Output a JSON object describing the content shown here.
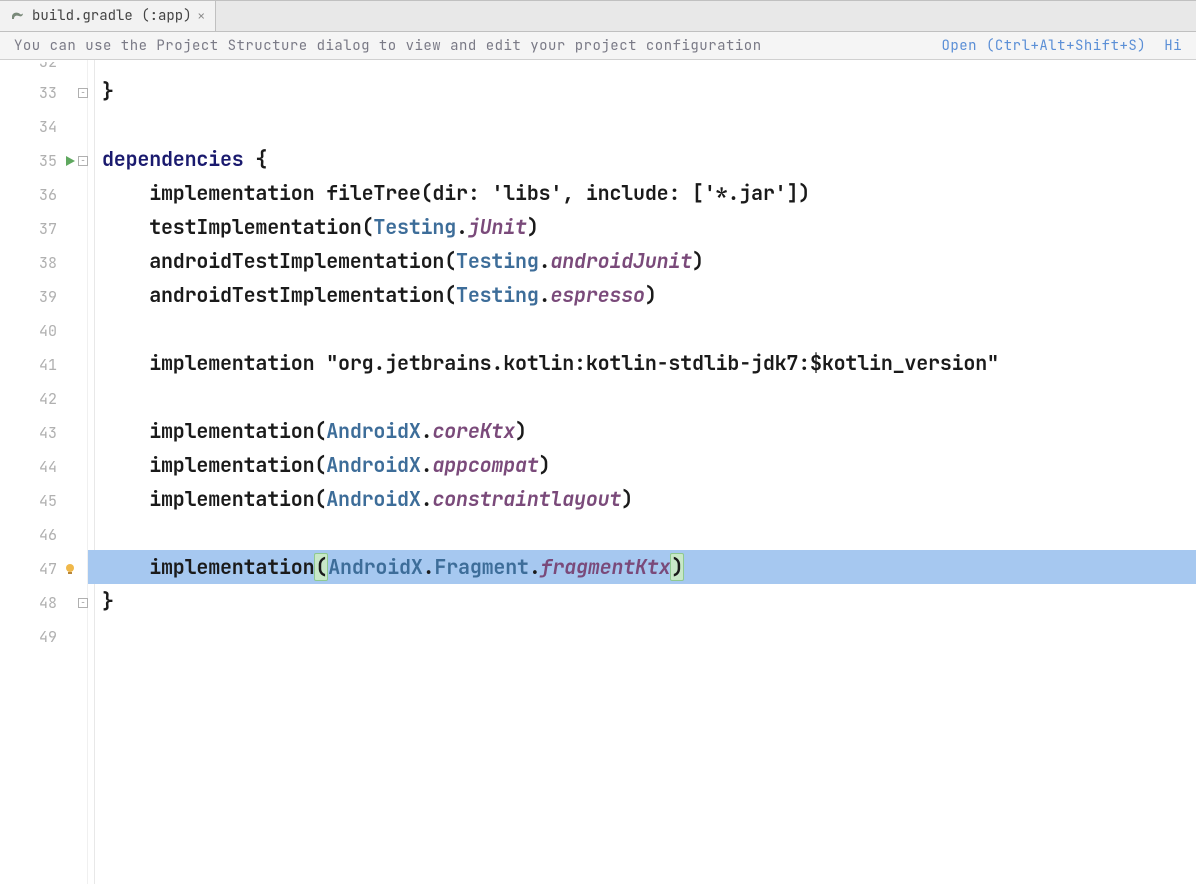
{
  "tab": {
    "label": "build.gradle (:app)"
  },
  "notice": {
    "text": "You can use the Project Structure dialog to view and edit your project configuration",
    "link1": "Open (Ctrl+Alt+Shift+S)",
    "link2": "Hi"
  },
  "lines": {
    "start": 32,
    "items": [
      {
        "num": 32,
        "partial": true
      },
      {
        "num": 33,
        "fold_close": true,
        "segments": [
          {
            "cls": "brace",
            "t": "}"
          }
        ]
      },
      {
        "num": 34,
        "segments": []
      },
      {
        "num": 35,
        "run": true,
        "fold_open": true,
        "segments": [
          {
            "cls": "kw",
            "t": "dependencies"
          },
          {
            "cls": "plain",
            "t": " "
          },
          {
            "cls": "brace",
            "t": "{"
          }
        ]
      },
      {
        "num": 36,
        "segments": [
          {
            "cls": "plain",
            "t": "    "
          },
          {
            "cls": "fn",
            "t": "implementation"
          },
          {
            "cls": "plain",
            "t": " "
          },
          {
            "cls": "fn",
            "t": "fileTree"
          },
          {
            "cls": "plain",
            "t": "(dir: "
          },
          {
            "cls": "str",
            "t": "'libs'"
          },
          {
            "cls": "plain",
            "t": ", include: ["
          },
          {
            "cls": "str",
            "t": "'*.jar'"
          },
          {
            "cls": "plain",
            "t": "])"
          }
        ]
      },
      {
        "num": 37,
        "segments": [
          {
            "cls": "plain",
            "t": "    "
          },
          {
            "cls": "fn",
            "t": "testImplementation"
          },
          {
            "cls": "plain",
            "t": "("
          },
          {
            "cls": "type",
            "t": "Testing"
          },
          {
            "cls": "plain",
            "t": "."
          },
          {
            "cls": "prop",
            "t": "jUnit"
          },
          {
            "cls": "plain",
            "t": ")"
          }
        ]
      },
      {
        "num": 38,
        "segments": [
          {
            "cls": "plain",
            "t": "    "
          },
          {
            "cls": "fn",
            "t": "androidTestImplementation"
          },
          {
            "cls": "plain",
            "t": "("
          },
          {
            "cls": "type",
            "t": "Testing"
          },
          {
            "cls": "plain",
            "t": "."
          },
          {
            "cls": "prop",
            "t": "androidJunit"
          },
          {
            "cls": "plain",
            "t": ")"
          }
        ]
      },
      {
        "num": 39,
        "segments": [
          {
            "cls": "plain",
            "t": "    "
          },
          {
            "cls": "fn",
            "t": "androidTestImplementation"
          },
          {
            "cls": "plain",
            "t": "("
          },
          {
            "cls": "type",
            "t": "Testing"
          },
          {
            "cls": "plain",
            "t": "."
          },
          {
            "cls": "prop",
            "t": "espresso"
          },
          {
            "cls": "plain",
            "t": ")"
          }
        ]
      },
      {
        "num": 40,
        "segments": []
      },
      {
        "num": 41,
        "segments": [
          {
            "cls": "plain",
            "t": "    "
          },
          {
            "cls": "fn",
            "t": "implementation"
          },
          {
            "cls": "plain",
            "t": " "
          },
          {
            "cls": "str",
            "t": "\"org.jetbrains.kotlin:kotlin-stdlib-jdk7:$kotlin_version\""
          }
        ]
      },
      {
        "num": 42,
        "segments": []
      },
      {
        "num": 43,
        "segments": [
          {
            "cls": "plain",
            "t": "    "
          },
          {
            "cls": "fn",
            "t": "implementation"
          },
          {
            "cls": "plain",
            "t": "("
          },
          {
            "cls": "type",
            "t": "AndroidX"
          },
          {
            "cls": "plain",
            "t": "."
          },
          {
            "cls": "prop",
            "t": "coreKtx"
          },
          {
            "cls": "plain",
            "t": ")"
          }
        ]
      },
      {
        "num": 44,
        "segments": [
          {
            "cls": "plain",
            "t": "    "
          },
          {
            "cls": "fn",
            "t": "implementation"
          },
          {
            "cls": "plain",
            "t": "("
          },
          {
            "cls": "type",
            "t": "AndroidX"
          },
          {
            "cls": "plain",
            "t": "."
          },
          {
            "cls": "prop",
            "t": "appcompat"
          },
          {
            "cls": "plain",
            "t": ")"
          }
        ]
      },
      {
        "num": 45,
        "segments": [
          {
            "cls": "plain",
            "t": "    "
          },
          {
            "cls": "fn",
            "t": "implementation"
          },
          {
            "cls": "plain",
            "t": "("
          },
          {
            "cls": "type",
            "t": "AndroidX"
          },
          {
            "cls": "plain",
            "t": "."
          },
          {
            "cls": "prop",
            "t": "constraintlayout"
          },
          {
            "cls": "plain",
            "t": ")"
          }
        ]
      },
      {
        "num": 46,
        "segments": []
      },
      {
        "num": 47,
        "highlighted": true,
        "bulb": true,
        "segments": [
          {
            "cls": "plain",
            "t": "    "
          },
          {
            "cls": "fn",
            "t": "implementation"
          },
          {
            "cls": "plain paren-match",
            "t": "("
          },
          {
            "cls": "type",
            "t": "AndroidX"
          },
          {
            "cls": "plain",
            "t": "."
          },
          {
            "cls": "type",
            "t": "Fragment"
          },
          {
            "cls": "plain",
            "t": "."
          },
          {
            "cls": "prop",
            "t": "fragmentKtx"
          },
          {
            "cls": "plain paren-match",
            "t": ")"
          }
        ]
      },
      {
        "num": 48,
        "fold_close": true,
        "segments": [
          {
            "cls": "brace",
            "t": "}"
          }
        ]
      },
      {
        "num": 49,
        "segments": []
      }
    ]
  }
}
